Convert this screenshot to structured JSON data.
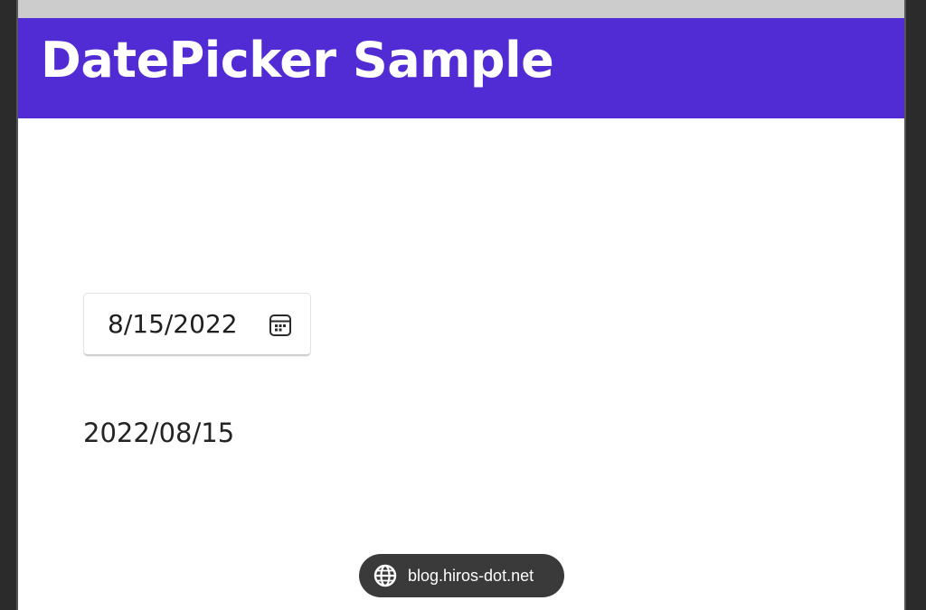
{
  "app": {
    "title": "DatePicker Sample",
    "header_color": "#512bd4"
  },
  "datepicker": {
    "value": "8/15/2022",
    "icon": "calendar-icon"
  },
  "selected_date": {
    "text": "2022/08/15"
  },
  "watermark": {
    "icon": "globe-icon",
    "text": "blog.hiros-dot.net"
  }
}
